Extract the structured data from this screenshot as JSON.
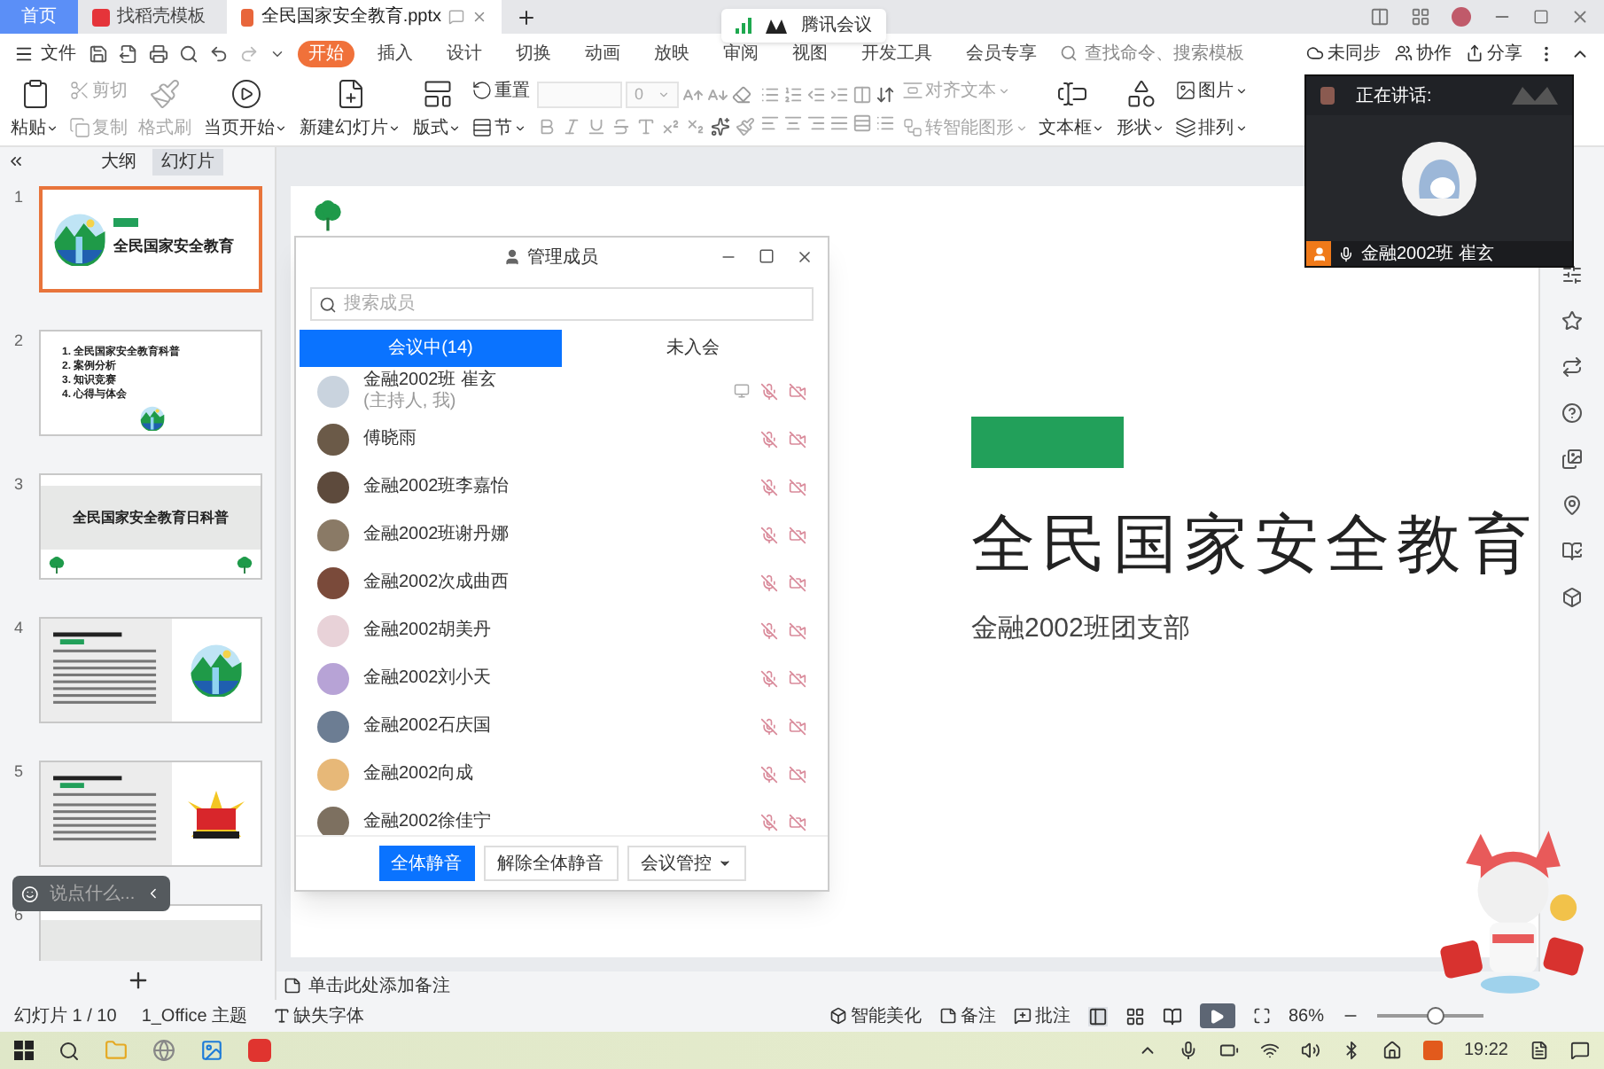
{
  "app_tabs": [
    {
      "label": "首页",
      "selected": false,
      "kind": "home"
    },
    {
      "label": "找稻壳模板",
      "selected": false,
      "kind": "template"
    },
    {
      "label": "全民国家安全教育.pptx",
      "selected": true,
      "kind": "doc"
    }
  ],
  "file_menu": "文件",
  "ribbon_tabs": [
    {
      "label": "开始",
      "selected": true
    },
    {
      "label": "插入",
      "selected": false
    },
    {
      "label": "设计",
      "selected": false
    },
    {
      "label": "切换",
      "selected": false
    },
    {
      "label": "动画",
      "selected": false
    },
    {
      "label": "放映",
      "selected": false
    },
    {
      "label": "审阅",
      "selected": false
    },
    {
      "label": "视图",
      "selected": false
    },
    {
      "label": "开发工具",
      "selected": false
    },
    {
      "label": "会员专享",
      "selected": false
    }
  ],
  "command_search": {
    "placeholder": "查找命令、搜索模板"
  },
  "account_actions": [
    {
      "label": "未同步",
      "kind": "sync"
    },
    {
      "label": "协作",
      "kind": "collab"
    },
    {
      "label": "分享",
      "kind": "share"
    }
  ],
  "ribbon_left": [
    {
      "label": "粘贴",
      "kind": "paste",
      "caret": true,
      "disabled": false
    },
    [
      {
        "label": "剪切",
        "kind": "cut",
        "caret": false,
        "disabled": true
      },
      {
        "label": "复制",
        "kind": "copy",
        "caret": false,
        "disabled": true
      }
    ],
    {
      "label": "格式刷",
      "kind": "brush",
      "caret": false,
      "disabled": true
    },
    {
      "label": "当页开始",
      "kind": "play",
      "caret": true,
      "disabled": false
    },
    {
      "label": "新建幻灯片",
      "kind": "newslide",
      "caret": true,
      "disabled": false
    },
    {
      "label": "版式",
      "kind": "layout",
      "caret": true,
      "disabled": false
    },
    [
      {
        "label": "重置",
        "kind": "reset",
        "caret": false,
        "disabled": false
      },
      {
        "label": "节",
        "kind": "section",
        "caret": true,
        "disabled": false
      }
    ]
  ],
  "font_size": "0",
  "ribbon_right": [
    [
      {
        "label": "对齐文本",
        "kind": "align",
        "caret": true,
        "disabled": true
      },
      {
        "label": "转智能图形",
        "kind": "smart",
        "caret": true,
        "disabled": true
      }
    ],
    {
      "label": "文本框",
      "kind": "textbox",
      "caret": true,
      "disabled": false
    },
    {
      "label": "形状",
      "kind": "shape",
      "caret": true,
      "disabled": false
    },
    [
      {
        "label": "图片",
        "kind": "picture",
        "caret": true,
        "disabled": false
      },
      {
        "label": "排列",
        "kind": "arrange",
        "caret": true,
        "disabled": false
      }
    ]
  ],
  "meeting_badge": "腾讯会议",
  "panel_tabs": [
    {
      "label": "大纲",
      "selected": false
    },
    {
      "label": "幻灯片",
      "selected": true
    }
  ],
  "slides": [
    {
      "number": "1",
      "selected": true,
      "kind": "title",
      "title": "全民国家安全教育"
    },
    {
      "number": "2",
      "selected": false,
      "kind": "agenda",
      "items": [
        "1. 全民国家安全教育科普",
        "2. 案例分析",
        "3. 知识竞赛",
        "4. 心得与体会"
      ]
    },
    {
      "number": "3",
      "selected": false,
      "kind": "section",
      "title": "全民国家安全教育日科普"
    },
    {
      "number": "4",
      "selected": false,
      "kind": "article"
    },
    {
      "number": "5",
      "selected": false,
      "kind": "poster"
    },
    {
      "number": "6",
      "selected": false,
      "kind": "blank"
    }
  ],
  "chat_box": {
    "placeholder": "说点什么..."
  },
  "slide": {
    "title": "全民国家安全教育",
    "subtitle": "金融2002班团支部"
  },
  "notes": {
    "placeholder": "单击此处添加备注"
  },
  "status_bar": {
    "slide_counter": "幻灯片 1 / 10",
    "theme": "1_Office 主题",
    "missing_font": "缺失字体",
    "beautify": "智能美化",
    "notes": "备注",
    "comments": "批注",
    "zoom": "86%",
    "zoom_slider": {
      "level": 0.55
    }
  },
  "members_dialog": {
    "title": "管理成员",
    "search": {
      "placeholder": "搜索成员"
    },
    "tabs": [
      {
        "label": "会议中(14)",
        "selected": true
      },
      {
        "label": "未入会",
        "selected": false
      }
    ],
    "members": [
      {
        "name": "金融2002班 崔玄",
        "note": "(主持人, 我)",
        "sharing": true,
        "muted": true,
        "color": "#c9d3de"
      },
      {
        "name": "傅晓雨",
        "sharing": false,
        "muted": true,
        "color": "#6b5a48"
      },
      {
        "name": "金融2002班李嘉怡",
        "sharing": false,
        "muted": true,
        "color": "#5d4a3c"
      },
      {
        "name": "金融2002班谢丹娜",
        "sharing": false,
        "muted": true,
        "color": "#8a7a66"
      },
      {
        "name": "金融2002次成曲西",
        "sharing": false,
        "muted": true,
        "color": "#7a4a3a"
      },
      {
        "name": "金融2002胡美丹",
        "sharing": false,
        "muted": true,
        "color": "#e8d2d8"
      },
      {
        "name": "金融2002刘小天",
        "sharing": false,
        "muted": true,
        "color": "#b7a3d6"
      },
      {
        "name": "金融2002石庆国",
        "sharing": false,
        "muted": true,
        "color": "#6c7d93"
      },
      {
        "name": "金融2002向成",
        "sharing": false,
        "muted": true,
        "color": "#e7b878"
      },
      {
        "name": "金融2002徐佳宁",
        "sharing": false,
        "muted": true,
        "color": "#7d7060"
      }
    ],
    "buttons": [
      {
        "label": "全体静音",
        "primary": true,
        "caret": false
      },
      {
        "label": "解除全体静音",
        "primary": false,
        "caret": false
      },
      {
        "label": "会议管控",
        "primary": false,
        "caret": true
      }
    ]
  },
  "speaker_panel": {
    "label": "正在讲话:",
    "speaker": "金融2002班 崔玄"
  },
  "taskbar": {
    "time": "19:22"
  }
}
